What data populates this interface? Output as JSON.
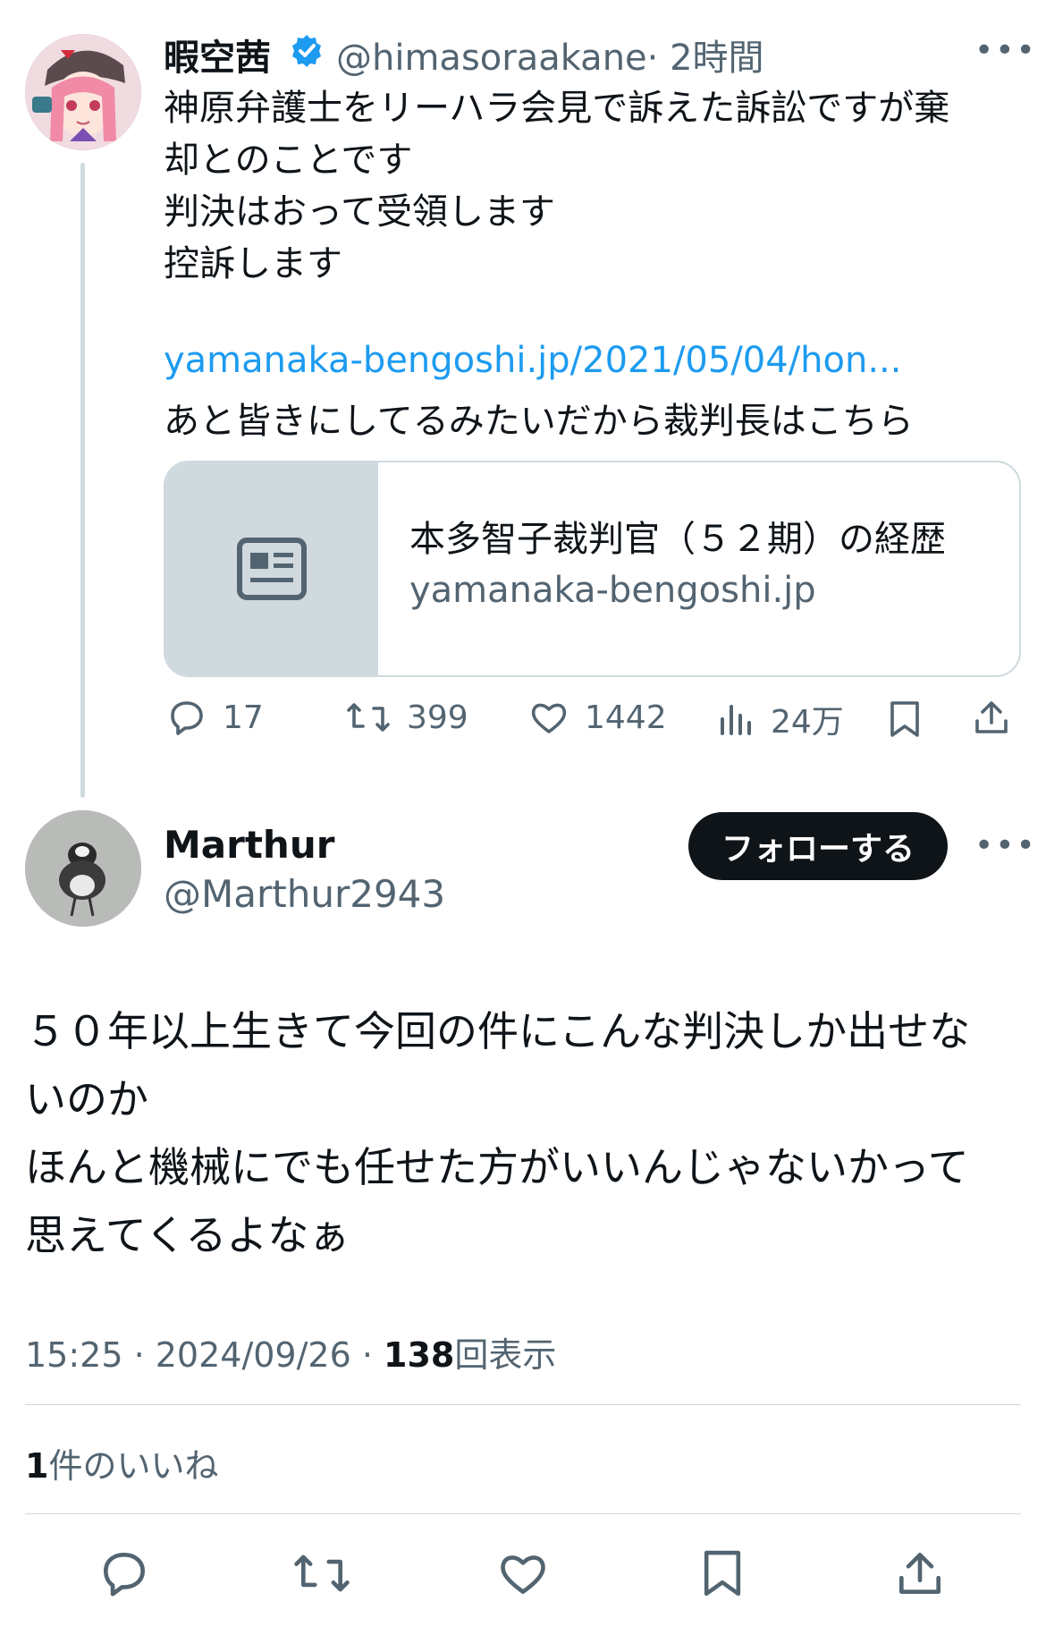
{
  "quoted_tweet": {
    "display_name": "暇空茜",
    "handle": "@himasoraakane",
    "time": "· 2時間",
    "more": "•••",
    "body_lines": "神原弁護士をリーハラ会見で訴えた訴訟ですが棄\n却とのことです\n判決はおって受領します\n控訴します",
    "link": "yamanaka-bengoshi.jp/2021/05/04/hon...",
    "body_after_link": "あと皆きにしてるみたいだから裁判長はこちら",
    "card": {
      "title": "本多智子裁判官（５２期）の経歴",
      "domain": "yamanaka-bengoshi.jp"
    },
    "actions": {
      "replies": "17",
      "retweets": "399",
      "likes": "1442",
      "views": "24万"
    }
  },
  "reply_tweet": {
    "display_name": "Marthur",
    "handle": "@Marthur2943",
    "follow_label": "フォローする",
    "more": "•••",
    "body": "５０年以上生きて今回の件にこんな判決しか出せな\nいのか\nほんと機械にでも任せた方がいいんじゃないかって\n思えてくるよなぁ",
    "timestamp": "15:25 · 2024/09/26 · ",
    "views_count": "138",
    "views_label": "回表示",
    "likes_count": "1",
    "likes_label": "件のいいね"
  },
  "colors": {
    "accent": "#1d9bf0",
    "text": "#0f1419",
    "secondary": "#536471",
    "border": "#cfd9de"
  },
  "icons": [
    "verified-badge-icon",
    "reply-icon",
    "retweet-icon",
    "like-icon",
    "views-icon",
    "bookmark-icon",
    "share-icon",
    "article-icon",
    "more-icon"
  ]
}
